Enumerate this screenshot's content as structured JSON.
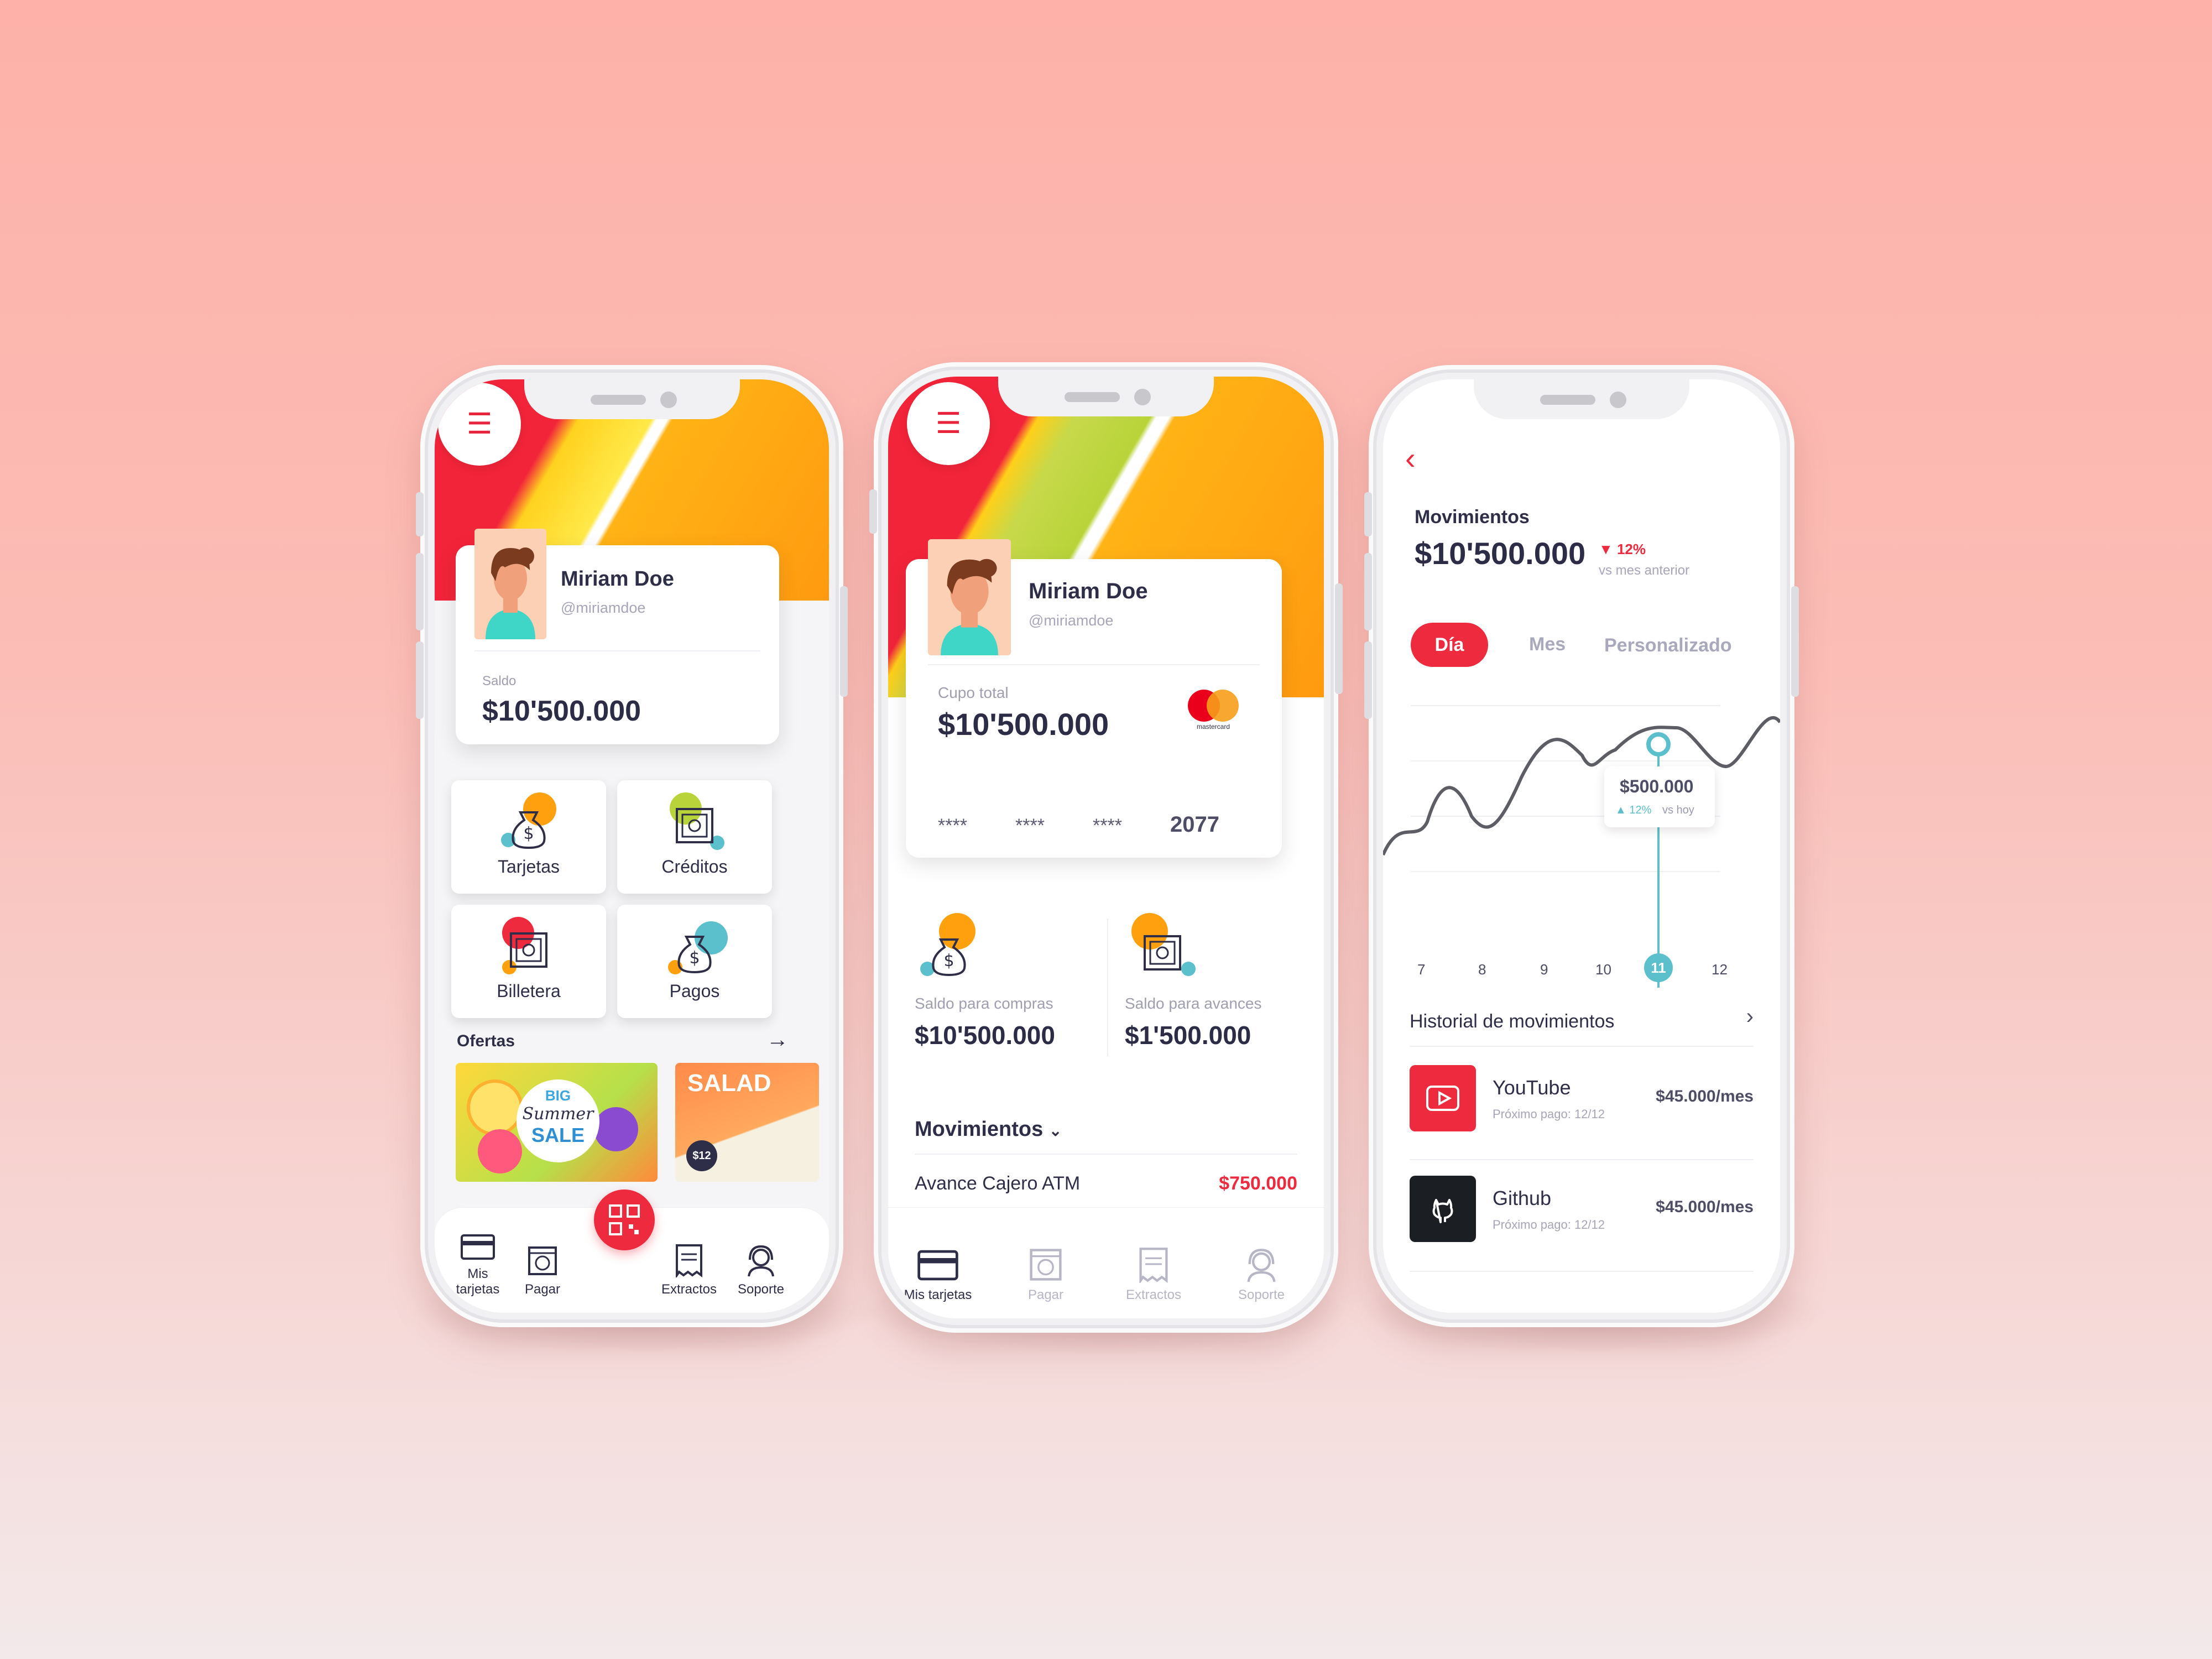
{
  "screen1": {
    "user": {
      "name": "Miriam Doe",
      "handle": "@miriamdoe"
    },
    "balance_label": "Saldo",
    "balance_value": "$10'500.000",
    "tiles": [
      "Tarjetas",
      "Créditos",
      "Billetera",
      "Pagos"
    ],
    "offers_label": "Ofertas",
    "promo1": {
      "big": "BIG",
      "summer": "Summer",
      "sale": "SALE"
    },
    "promo2": {
      "title": "SALAD",
      "price": "$12"
    },
    "nav": [
      "Mis tarjetas",
      "Pagar",
      "Extractos",
      "Soporte"
    ]
  },
  "screen2": {
    "user": {
      "name": "Miriam Doe",
      "handle": "@miriamdoe"
    },
    "limit_label": "Cupo total",
    "limit_value": "$10'500.000",
    "card_groups": [
      "****",
      "****",
      "****",
      "2077"
    ],
    "card_brand": "mastercard",
    "purchases_label": "Saldo para compras",
    "purchases_value": "$10'500.000",
    "advances_label": "Saldo para avances",
    "advances_value": "$1'500.000",
    "movements_label": "Movimientos",
    "movement": {
      "title": "Avance Cajero ATM",
      "amount": "$750.000"
    },
    "nav": [
      "Mis tarjetas",
      "Pagar",
      "Extractos",
      "Soporte"
    ]
  },
  "screen3": {
    "title": "Movimientos",
    "total": "$10'500.000",
    "change": "12%",
    "change_sub": "vs mes anterior",
    "tabs": [
      "Día",
      "Mes",
      "Personalizado"
    ],
    "tooltip": {
      "value": "$500.000",
      "change": "12%",
      "sub": "vs hoy"
    },
    "x_ticks": [
      "7",
      "8",
      "9",
      "10",
      "11",
      "12"
    ],
    "history_label": "Historial de movimientos",
    "items": [
      {
        "title": "YouTube",
        "sub": "Próximo pago: 12/12",
        "amount": "$45.000/mes"
      },
      {
        "title": "Github",
        "sub": "Próximo pago: 12/12",
        "amount": "$45.000/mes"
      }
    ]
  },
  "colors": {
    "accent": "#ee2a3f",
    "teal": "#5bc0cc",
    "orange": "#ffa10f",
    "green": "#b8d43a",
    "text": "#2e2e48"
  }
}
